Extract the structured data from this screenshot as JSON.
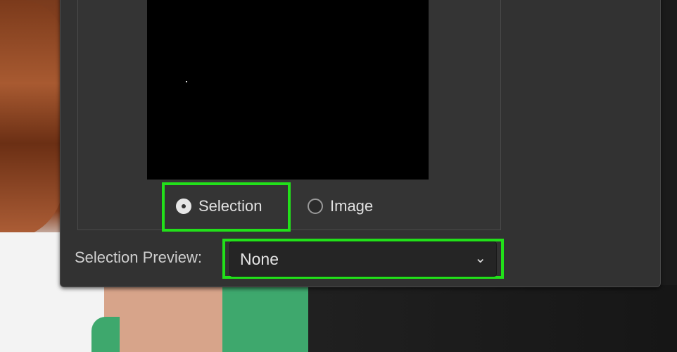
{
  "dialog": {
    "output_options": [
      {
        "label": "Selection",
        "selected": true
      },
      {
        "label": "Image",
        "selected": false
      }
    ],
    "selection_preview": {
      "label": "Selection Preview:",
      "value": "None"
    }
  },
  "colors": {
    "highlight": "#22e01a",
    "dialog_bg": "#323232",
    "canvas_bg": "#000000"
  },
  "icons": {
    "dropdown": "chevron-down-icon"
  }
}
